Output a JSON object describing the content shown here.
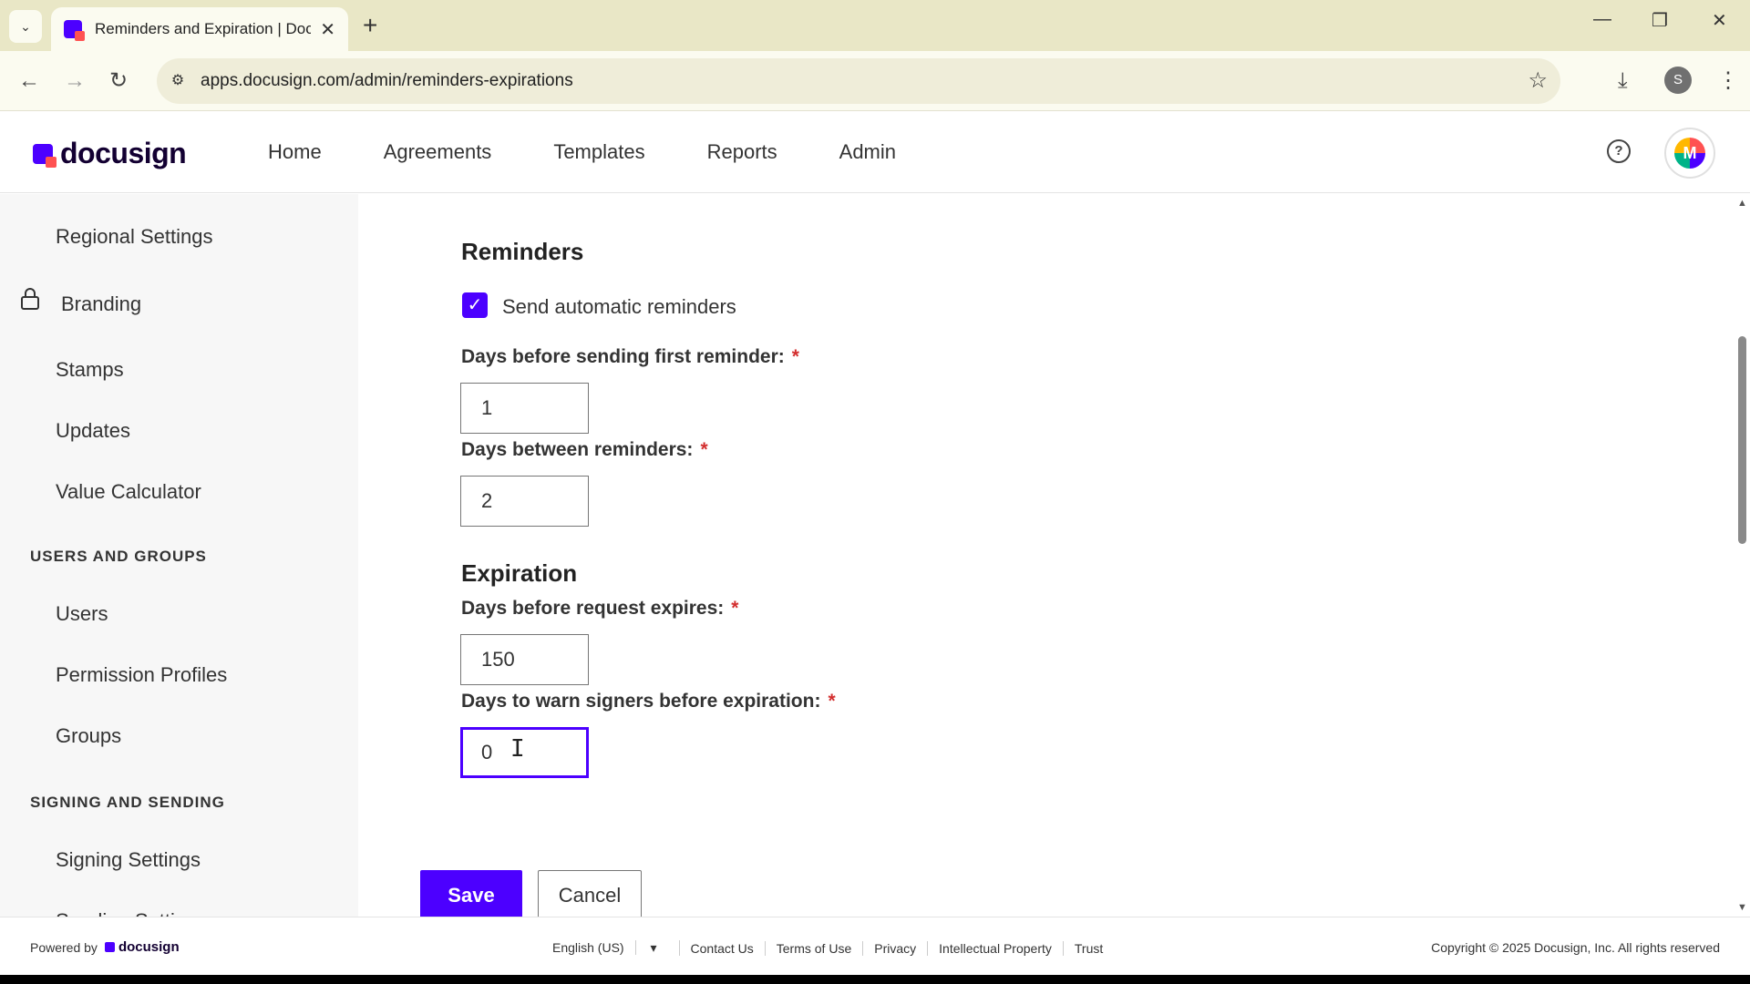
{
  "browser": {
    "tab_title": "Reminders and Expiration | Doc",
    "url": "apps.docusign.com/admin/reminders-expirations",
    "profile_letter": "S"
  },
  "header": {
    "logo_text": "docusign",
    "nav": [
      "Home",
      "Agreements",
      "Templates",
      "Reports",
      "Admin"
    ],
    "help": "?",
    "avatar_letter": "M"
  },
  "sidebar": {
    "items_top": [
      "Regional Settings",
      "Branding",
      "Stamps",
      "Updates",
      "Value Calculator"
    ],
    "users_header": "USERS AND GROUPS",
    "users_items": [
      "Users",
      "Permission Profiles",
      "Groups"
    ],
    "signing_header": "SIGNING AND SENDING",
    "signing_items": [
      "Signing Settings",
      "Sending Settings"
    ]
  },
  "reminders": {
    "title": "Reminders",
    "auto_label": "Send automatic reminders",
    "auto_checked": true,
    "first_label": "Days before sending first reminder:",
    "first_value": "1",
    "between_label": "Days between reminders:",
    "between_value": "2"
  },
  "expiration": {
    "title": "Expiration",
    "expires_label": "Days before request expires:",
    "expires_value": "150",
    "warn_label": "Days to warn signers before expiration:",
    "warn_value": "0"
  },
  "required_mark": "*",
  "buttons": {
    "save": "Save",
    "cancel": "Cancel"
  },
  "footer": {
    "powered_by": "Powered by",
    "powered_logo": "docusign",
    "language": "English (US)",
    "links": [
      "Contact Us",
      "Terms of Use",
      "Privacy",
      "Intellectual Property",
      "Trust"
    ],
    "copyright": "Copyright © 2025 Docusign, Inc. All rights reserved"
  },
  "colors": {
    "accent": "#4c00ff",
    "brand_red": "#ff5252",
    "required": "#d32f2f"
  }
}
